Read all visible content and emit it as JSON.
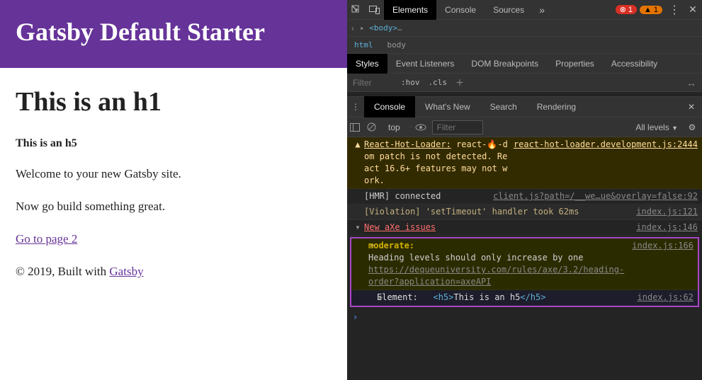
{
  "page": {
    "siteTitle": "Gatsby Default Starter",
    "h1": "This is an h1",
    "h5": "This is an h5",
    "p1": "Welcome to your new Gatsby site.",
    "p2": "Now go build something great.",
    "link": "Go to page 2",
    "footerPrefix": "© 2019, Built with ",
    "footerLink": "Gatsby"
  },
  "devtools": {
    "topTabs": {
      "elements": "Elements",
      "console": "Console",
      "sources": "Sources"
    },
    "errorCount": "1",
    "warnCount": "1",
    "breadcrumb": {
      "hidden": "<body>",
      "html": "html",
      "body": "body"
    },
    "stylesTabs": {
      "styles": "Styles",
      "eventListeners": "Event Listeners",
      "domBreakpoints": "DOM Breakpoints",
      "properties": "Properties",
      "accessibility": "Accessibility"
    },
    "stylesFilter": {
      "placeholder": "Filter",
      "hov": ":hov",
      "cls": ".cls"
    },
    "drawerTabs": {
      "console": "Console",
      "whatsNew": "What's New",
      "search": "Search",
      "rendering": "Rendering"
    },
    "consoleToolbar": {
      "context": "top",
      "filterPlaceholder": "Filter",
      "levels": "All levels"
    },
    "log": {
      "warn1": {
        "prefix": "React-Hot-Loader:",
        "body": "react-🔥-dom patch is not detected. React 16.6+ features may not work.",
        "src": "react-hot-loader.development.js:2444"
      },
      "hmr": {
        "msg": "[HMR] connected",
        "src": "client.js?path=/__we…ue&overlay=false:92"
      },
      "violation": {
        "msg": "[Violation] 'setTimeout' handler took 62ms",
        "src": "index.js:121"
      },
      "axeHeader": {
        "msg": "New aXe issues",
        "src": "index.js:146"
      },
      "moderate": {
        "label": "moderate:",
        "text": "Heading levels should only increase by one",
        "link": "https://dequeuniversity.com/rules/axe/3.2/heading-order?application=axeAPI",
        "src": "index.js:166"
      },
      "element": {
        "label": "Element:",
        "open": "<h5>",
        "text": "This is an h5",
        "close": "</h5>",
        "src": "index.js:62"
      }
    }
  }
}
